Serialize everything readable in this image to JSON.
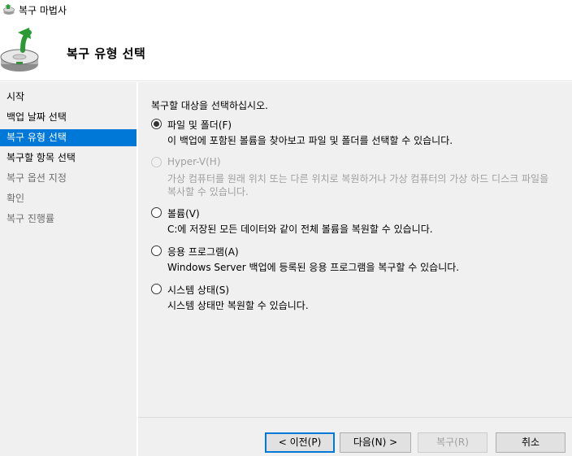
{
  "window": {
    "title": "복구 마법사"
  },
  "header": {
    "heading": "복구 유형 선택"
  },
  "sidebar": {
    "steps": [
      {
        "label": "시작",
        "state": "done"
      },
      {
        "label": "백업 날짜 선택",
        "state": "done"
      },
      {
        "label": "복구 유형 선택",
        "state": "active"
      },
      {
        "label": "복구할 항목 선택",
        "state": "next"
      },
      {
        "label": "복구 옵션 지정",
        "state": "pending"
      },
      {
        "label": "확인",
        "state": "pending"
      },
      {
        "label": "복구 진행률",
        "state": "pending"
      }
    ]
  },
  "main": {
    "prompt": "복구할 대상을 선택하십시오.",
    "options": [
      {
        "label": "파일 및 폴더(F)",
        "description": [
          "이 백업에 포함된 볼륨을 찾아보고 파일 및 폴더를 선택할 수 있습니다."
        ],
        "checked": true,
        "enabled": true
      },
      {
        "label": "Hyper-V(H)",
        "description": [
          "가상 컴퓨터를 원래 위치 또는 다른 위치로 복원하거나 가상 컴퓨터의 가상 하드 디스크 파일을",
          "복사할 수 있습니다."
        ],
        "checked": false,
        "enabled": false
      },
      {
        "label": "볼륨(V)",
        "description": [
          "C:에 저장된 모든 데이터와 같이 전체 볼륨을 복원할 수 있습니다."
        ],
        "checked": false,
        "enabled": true
      },
      {
        "label": "응용 프로그램(A)",
        "description": [
          "Windows Server 백업에 등록된 응용 프로그램을 복구할 수 있습니다."
        ],
        "checked": false,
        "enabled": true
      },
      {
        "label": "시스템 상태(S)",
        "description": [
          "시스템 상태만 복원할 수 있습니다."
        ],
        "checked": false,
        "enabled": true
      }
    ]
  },
  "footer": {
    "prev_label": "< 이전(P)",
    "next_label": "다음(N) >",
    "recover_label": "복구(R)",
    "cancel_label": "취소"
  },
  "colors": {
    "accent": "#0078d7",
    "panel": "#f0f0f0",
    "disabled_text": "#a0a0a0"
  },
  "icons": {
    "app": "backup-disk-icon",
    "header": "recovery-disk-arrow-icon"
  }
}
